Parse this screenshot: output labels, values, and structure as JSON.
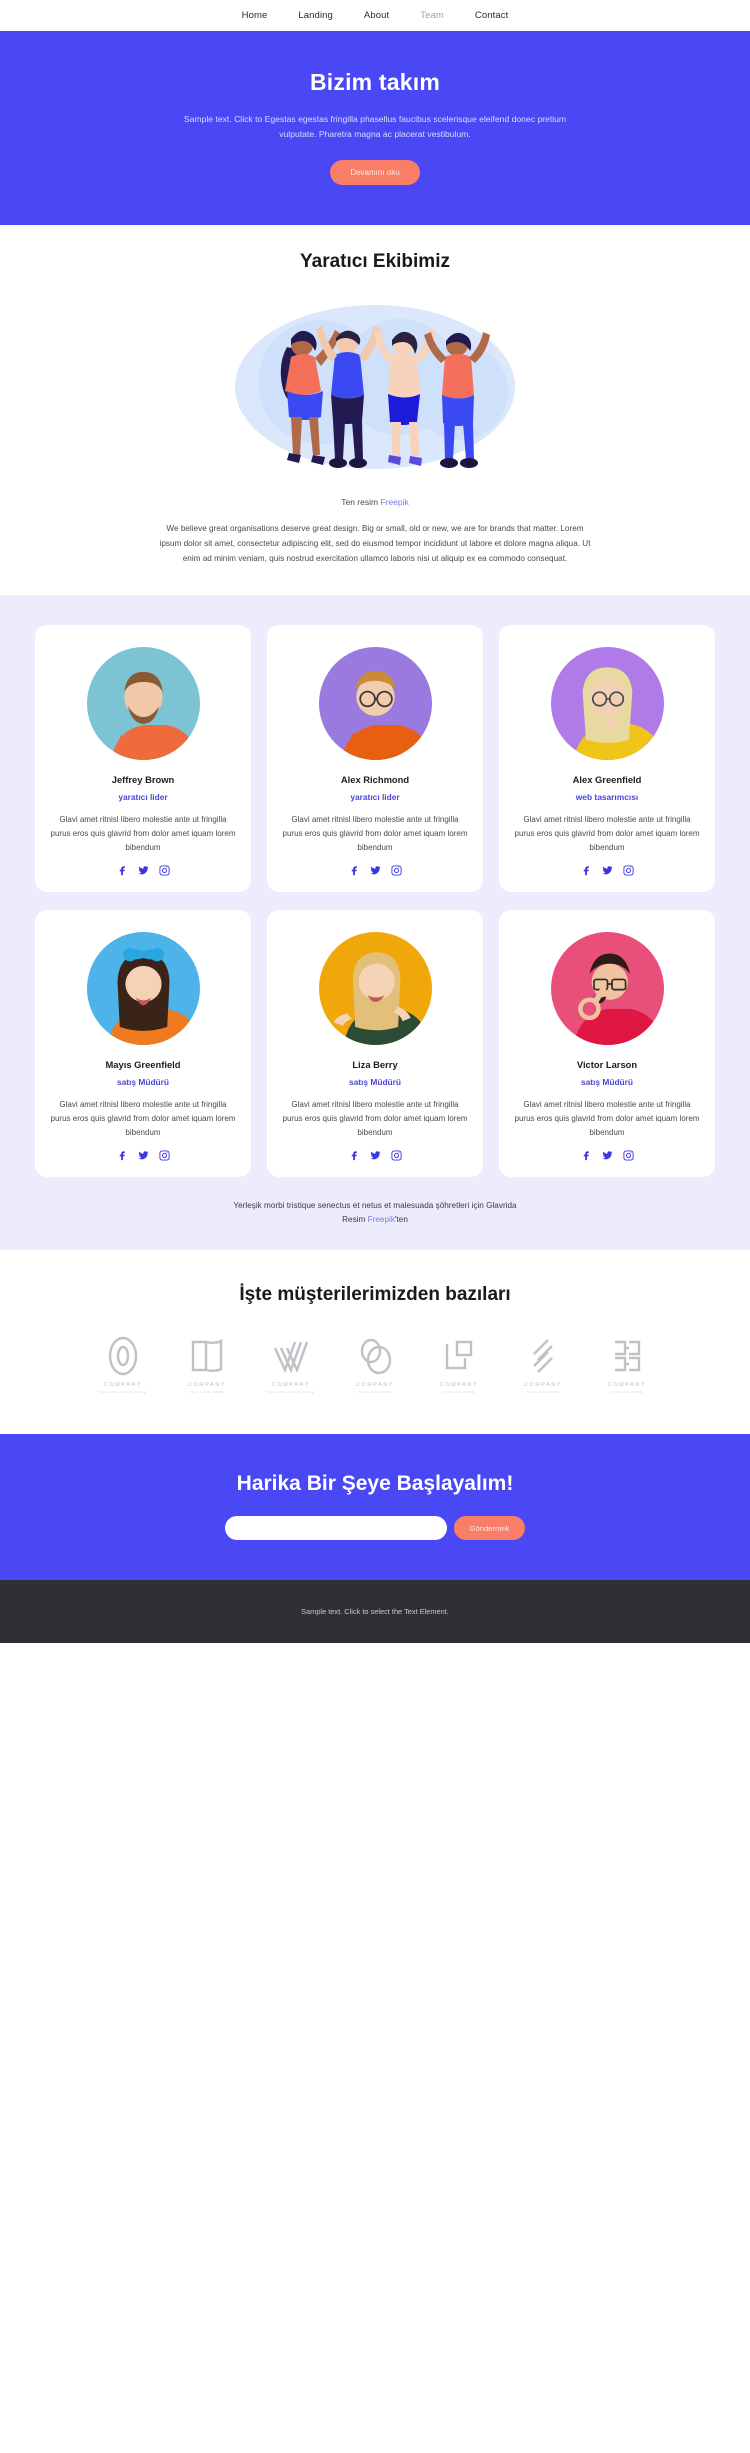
{
  "nav": {
    "items": [
      {
        "label": "Home",
        "active": false
      },
      {
        "label": "Landing",
        "active": false
      },
      {
        "label": "About",
        "active": false
      },
      {
        "label": "Team",
        "active": true
      },
      {
        "label": "Contact",
        "active": false
      }
    ]
  },
  "hero": {
    "title": "Bizim takım",
    "subtitle": "Sample text. Click to Egestas egestas fringilla phasellus faucibus scelerisque eleifend donec pretium vulputate. Pharetra magna ac placerat vestibulum.",
    "button": "Devamını oku",
    "bg_color": "#4a47f5",
    "button_color": "#f97e67"
  },
  "creative": {
    "title": "Yaratıcı Ekibimiz",
    "caption_prefix": "Ten resim ",
    "caption_link": "Freepik",
    "body": "We believe great organisations deserve great design. Big or small, old or new, we are for brands that matter. Lorem ipsum dolor sit amet, consectetur adipiscing elit, sed do eiusmod tempor incididunt ut labore et dolore magna aliqua. Ut enim ad minim veniam, quis nostrud exercitation ullamco laboris nisi ut aliquip ex ea commodo consequat."
  },
  "team": {
    "desc_default": "Glavi amet ritnisl libero molestie ante ut fringilla purus eros quis glavrid from dolor amet iquam lorem bibendum",
    "socials": [
      "facebook-icon",
      "twitter-icon",
      "instagram-icon"
    ],
    "members": [
      {
        "name": "Jeffrey Brown",
        "role": "yaratıcı lider",
        "desc": "Glavi amet ritnisl libero molestie ante ut fringilla purus eros quis glavrid from dolor amet iquam lorem bibendum",
        "bg": "#7cc4d4",
        "shirt": "#ef6b3d",
        "hair": "#8a5a36",
        "skin": "#f0c9a8"
      },
      {
        "name": "Alex Richmond",
        "role": "yaratıcı lider",
        "desc": "Glavi amet ritnisl libero molestie ante ut fringilla purus eros quis glavrid from dolor amet iquam lorem bibendum",
        "bg": "#9b7ae0",
        "shirt": "#e8600f",
        "hair": "#c98b3a",
        "skin": "#f2cdad"
      },
      {
        "name": "Alex Greenfield",
        "role": "web tasarımcısı",
        "desc": "Glavi amet ritnisl libero molestie ante ut fringilla purus eros quis glavrid from dolor amet iquam lorem bibendum",
        "bg": "#b07be6",
        "shirt": "#f0c419",
        "hair": "#e8d9a0",
        "skin": "#f3d0b4"
      },
      {
        "name": "Mayıs Greenfield",
        "role": "satış Müdürü",
        "desc": "Glavi amet ritnisl libero molestie ante ut fringilla purus eros quis glavrid from dolor amet iquam lorem bibendum",
        "bg": "#4db3e8",
        "shirt": "#f07a1f",
        "hair": "#3a2318",
        "skin": "#f4d2b6"
      },
      {
        "name": "Liza Berry",
        "role": "satış Müdürü",
        "desc": "Glavi amet ritnisl libero molestie ante ut fringilla purus eros quis glavrid from dolor amet iquam lorem bibendum",
        "bg": "#f0a70a",
        "shirt": "#2d4a34",
        "hair": "#e3c07a",
        "skin": "#f5d3b6"
      },
      {
        "name": "Victor Larson",
        "role": "satış Müdürü",
        "desc": "Glavi amet ritnisl libero molestie ante ut fringilla purus eros quis glavrid from dolor amet iquam lorem bibendum",
        "bg": "#e84f7a",
        "shirt": "#e01742",
        "hair": "#2b1d14",
        "skin": "#f0c3a0"
      }
    ],
    "note_line1": "Yerleşik morbi tristique senectus et netus et malesuada şöhretleri için Glavrida",
    "note_line2_prefix": "Resim ",
    "note_line2_link": "Freepik",
    "note_line2_suffix": "'ten"
  },
  "clients": {
    "title": "İşte müşterilerimizden bazıları",
    "logos": [
      {
        "name": "COMPANY",
        "tagline": "TAGLINE GOES HERE",
        "mark": "oval-loop-logo"
      },
      {
        "name": "COMPANY",
        "tagline": "TAG LINE HERE",
        "mark": "open-book-logo"
      },
      {
        "name": "COMPANY",
        "tagline": "TAGLINE GOES HERE",
        "mark": "chevron-lines-logo"
      },
      {
        "name": "COMPANY",
        "tagline": "TAGLINE HERE",
        "mark": "double-circle-logo"
      },
      {
        "name": "COMPANY",
        "tagline": "TAGLINE HERE",
        "mark": "squares-logo"
      },
      {
        "name": "COMPANY",
        "tagline": "TAGLINE HERE",
        "mark": "slash-stripes-logo"
      },
      {
        "name": "COMPANY",
        "tagline": "TAGLINE HERE",
        "mark": "blocks-logo"
      }
    ]
  },
  "cta": {
    "title": "Harika Bir Şeye Başlayalım!",
    "input_value": "",
    "input_placeholder": "",
    "button": "Göndermek"
  },
  "footer": {
    "text": "Sample text. Click to select the Text Element."
  }
}
